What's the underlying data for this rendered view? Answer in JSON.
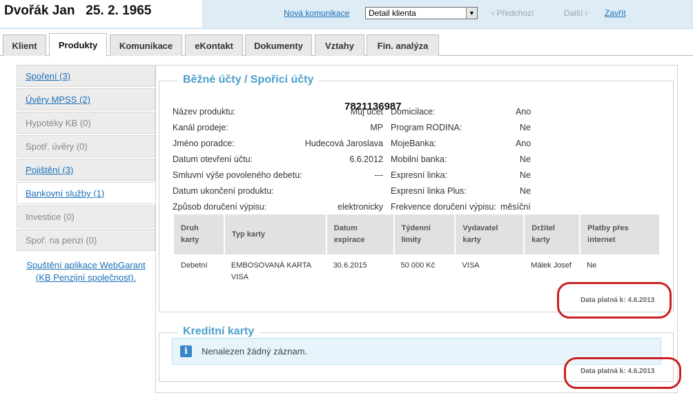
{
  "header": {
    "client": "Dvořák Jan   25. 2. 1965",
    "new_comm": "Nová komunikace",
    "select_value": "Detail klienta",
    "prev": "‹ Předchozí",
    "next": "Další ›",
    "close": "Zavřít"
  },
  "tabs": [
    "Klient",
    "Produkty",
    "Komunikace",
    "eKontakt",
    "Dokumenty",
    "Vztahy",
    "Fin. analýza"
  ],
  "sidebar": {
    "items": [
      {
        "label": "Spoření (3)"
      },
      {
        "label": "Úvěry MPSS (2)"
      },
      {
        "label": "Hypotéky KB (0)"
      },
      {
        "label": "Spotř. úvěry (0)"
      },
      {
        "label": "Pojištění (3)"
      },
      {
        "label": "Bankovní služby (1)"
      },
      {
        "label": "Investice (0)"
      },
      {
        "label": "Spoř. na penzi (0)"
      }
    ],
    "extra_line1": "Spuštění aplikace WebGarant",
    "extra_line2": "(KB Penzijní společnost)."
  },
  "accounts": {
    "title": "Běžné účty / Spořicí účty",
    "account_number": "7821136987",
    "left_fields": [
      {
        "label": "Název produktu:",
        "value": "Můj účet"
      },
      {
        "label": "Kanál prodeje:",
        "value": "MP"
      },
      {
        "label": "Jméno poradce:",
        "value": "Hudecová Jaroslava"
      },
      {
        "label": "Datum otevření účtu:",
        "value": "6.6.2012"
      },
      {
        "label": "Smluvní výše povoleného debetu:",
        "value": "---"
      },
      {
        "label": "Datum ukončení produktu:",
        "value": ""
      },
      {
        "label": "Způsob doručení výpisu:",
        "value": "elektronicky"
      }
    ],
    "right_fields": [
      {
        "label": "Domicilace:",
        "value": "Ano"
      },
      {
        "label": "Program RODINA:",
        "value": "Ne"
      },
      {
        "label": "MojeBanka:",
        "value": "Ano"
      },
      {
        "label": "Mobilní banka:",
        "value": "Ne"
      },
      {
        "label": "Expresní linka:",
        "value": "Ne"
      },
      {
        "label": "Expresní linka Plus:",
        "value": "Ne"
      },
      {
        "label": "Frekvence doručení výpisu:",
        "value": "měsíční"
      }
    ],
    "card_headers": [
      [
        "Druh",
        "karty"
      ],
      [
        "Typ karty"
      ],
      [
        "Datum",
        "expirace"
      ],
      [
        "Týdenní",
        "limity"
      ],
      [
        "Vydavatel",
        "karty"
      ],
      [
        "Držitel",
        "karty"
      ],
      [
        "Platby přes",
        "internet"
      ]
    ],
    "card_row": [
      [
        "Debetní"
      ],
      [
        "EMBOSOVANÁ KARTA",
        "VISA"
      ],
      [
        "30.6.2015"
      ],
      [
        "50 000 Kč"
      ],
      [
        "VISA"
      ],
      [
        "Málek Josef"
      ],
      [
        "Ne"
      ]
    ],
    "valid": "Data platná k: 4.6.2013"
  },
  "credit": {
    "title": "Kreditní karty",
    "empty_msg": "Nenalezen žádný záznam.",
    "valid": "Data platná k: 4.6.2013"
  },
  "colors": {
    "accent": "#4a9fc9",
    "link": "#1a6fb8",
    "highlight": "#cc1e1e"
  }
}
